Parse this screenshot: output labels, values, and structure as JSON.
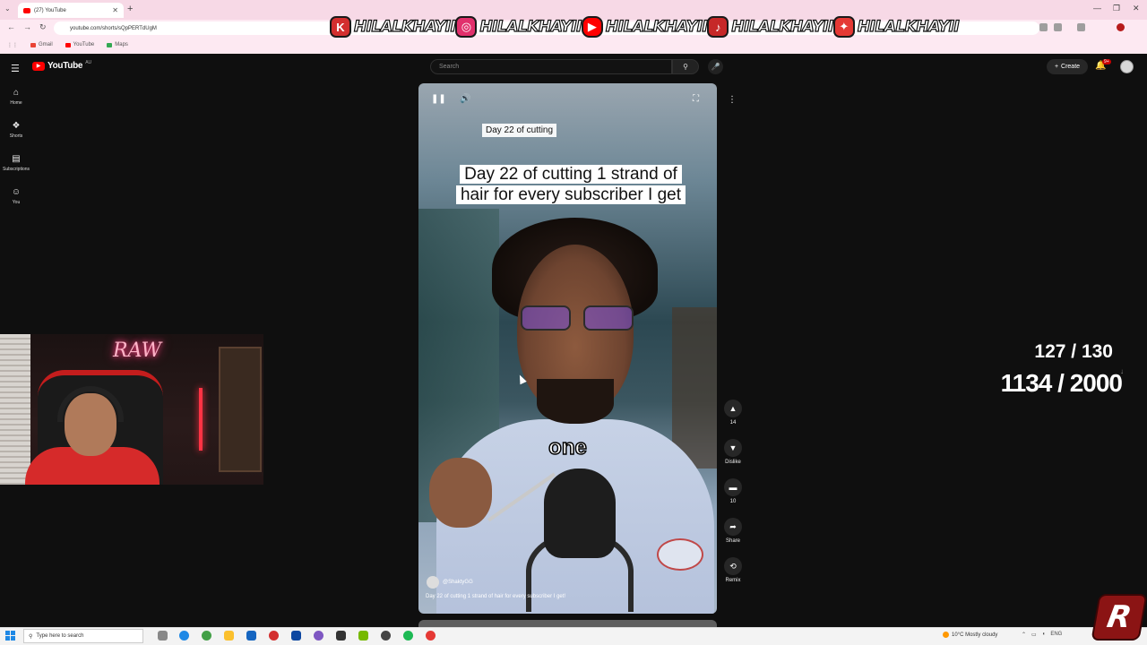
{
  "browser": {
    "tab_title": "(27) YouTube",
    "url": "youtube.com/shorts/sQpPERTdUgM",
    "bookmarks": [
      {
        "label": "Gmail",
        "color": "#ea4335"
      },
      {
        "label": "YouTube",
        "color": "#ff0000"
      },
      {
        "label": "Maps",
        "color": "#34a853"
      }
    ]
  },
  "social_banner": [
    {
      "icon": "kick-icon",
      "glyph": "K",
      "name": "HILALKHAYII"
    },
    {
      "icon": "instagram-icon",
      "glyph": "◎",
      "name": "HILALKHAYII"
    },
    {
      "icon": "youtube-icon",
      "glyph": "▶",
      "name": "HILALKHAYII"
    },
    {
      "icon": "tiktok-icon",
      "glyph": "♪",
      "name": "HILALKHAYII"
    },
    {
      "icon": "twitter-icon",
      "glyph": "✦",
      "name": "HILALKHAYII"
    }
  ],
  "youtube": {
    "logo_text": "YouTube",
    "country_code": "AU",
    "search_placeholder": "Search",
    "create_label": "Create",
    "notification_count": "9+",
    "sidebar": [
      {
        "label": "Home",
        "icon": "home-icon",
        "glyph": "⌂"
      },
      {
        "label": "Shorts",
        "icon": "shorts-icon",
        "glyph": "❖"
      },
      {
        "label": "Subscriptions",
        "icon": "subscriptions-icon",
        "glyph": "▤"
      },
      {
        "label": "You",
        "icon": "you-icon",
        "glyph": "☺"
      }
    ]
  },
  "short": {
    "title_overlay": "Day 22 of cutting",
    "caption": "Day 22 of cutting 1 strand of hair for every subscriber I get",
    "subtitle_word": "one",
    "channel": "@ShaktyGG",
    "description": "Day 22 of cutting 1 strand of hair for every subscriber I get!",
    "actions": [
      {
        "icon": "like-icon",
        "glyph": "👍",
        "label": "14"
      },
      {
        "icon": "dislike-icon",
        "glyph": "👎",
        "label": "Dislike"
      },
      {
        "icon": "comment-icon",
        "glyph": "▭",
        "label": "10"
      },
      {
        "icon": "share-icon",
        "glyph": "➦",
        "label": "Share"
      },
      {
        "icon": "remix-icon",
        "glyph": "⟲",
        "label": "Remix"
      }
    ]
  },
  "stream": {
    "neon_sign": "RAW",
    "counter_subs": "127 / 130",
    "counter_goal": "1134 / 2000"
  },
  "taskbar": {
    "search_placeholder": "Type here to search",
    "weather": "10°C  Mostly cloudy",
    "language": "ENG"
  }
}
